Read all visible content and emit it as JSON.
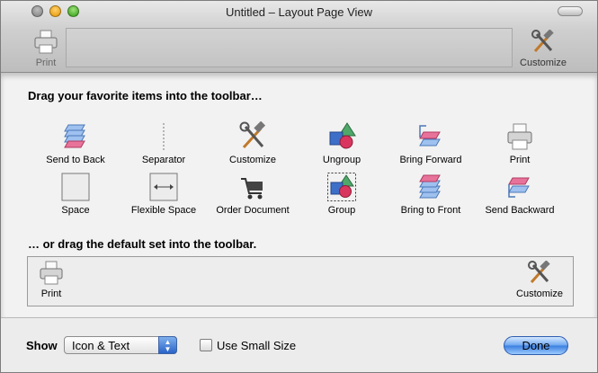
{
  "window": {
    "title": "Untitled – Layout Page View"
  },
  "toolbar": {
    "print_label": "Print",
    "customize_label": "Customize"
  },
  "sheet": {
    "heading_favorites": "Drag your favorite items into the toolbar…",
    "heading_default": "… or drag the default set into the toolbar.",
    "items": [
      {
        "label": "Send to Back",
        "icon": "send-to-back-icon"
      },
      {
        "label": "Separator",
        "icon": "separator-icon"
      },
      {
        "label": "Customize",
        "icon": "customize-icon"
      },
      {
        "label": "Ungroup",
        "icon": "ungroup-icon"
      },
      {
        "label": "Bring Forward",
        "icon": "bring-forward-icon"
      },
      {
        "label": "Print",
        "icon": "print-icon"
      },
      {
        "label": "Space",
        "icon": "space-icon"
      },
      {
        "label": "Flexible Space",
        "icon": "flexible-space-icon"
      },
      {
        "label": "Order Document",
        "icon": "cart-icon"
      },
      {
        "label": "Group",
        "icon": "group-icon"
      },
      {
        "label": "Bring to Front",
        "icon": "bring-to-front-icon"
      },
      {
        "label": "Send Backward",
        "icon": "send-backward-icon"
      }
    ],
    "default_set": {
      "print_label": "Print",
      "customize_label": "Customize"
    }
  },
  "bottom": {
    "show_label": "Show",
    "show_value": "Icon & Text",
    "small_size_label": "Use Small Size",
    "small_size_checked": false,
    "done_label": "Done"
  },
  "colors": {
    "accent": "#3a7ee0",
    "layer_pink": "#e8739a",
    "layer_blue": "#6f9fe0"
  }
}
